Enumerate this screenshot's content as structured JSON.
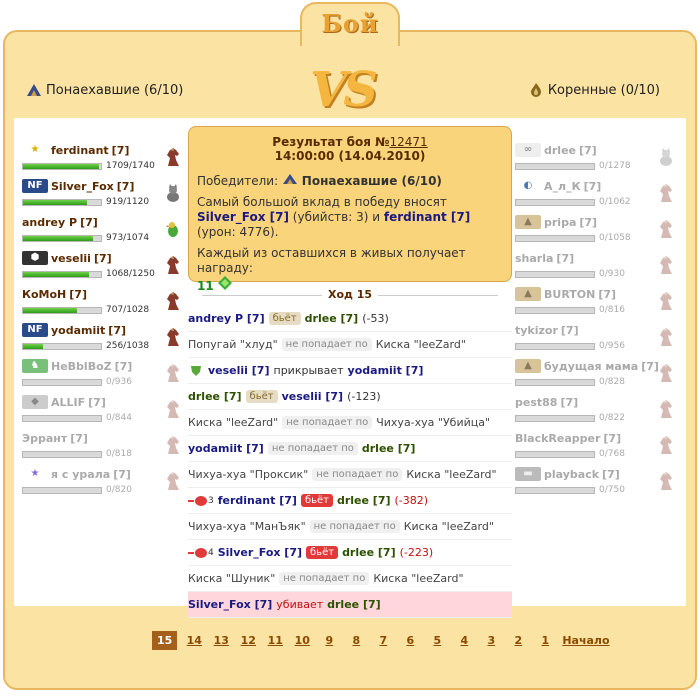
{
  "title": "Бой",
  "vs": "VS",
  "teams": {
    "left": {
      "name": "Понаехавшие (6/10)",
      "icon": "mountain-icon"
    },
    "right": {
      "name": "Коренные (0/10)",
      "icon": "flame-icon"
    }
  },
  "left_fighters": [
    {
      "name": "ferdinant",
      "lvl": "[7]",
      "hp": "1709/1740",
      "hp_frac": 0.98,
      "clan": "star-icon",
      "sign": "horse-icon",
      "dead": false
    },
    {
      "name": "Silver_Fox",
      "lvl": "[7]",
      "hp": "919/1120",
      "hp_frac": 0.82,
      "clan": "nf-clan-icon",
      "sign": "cat-icon",
      "dead": false
    },
    {
      "name": "andrey P",
      "lvl": "[7]",
      "hp": "973/1074",
      "hp_frac": 0.9,
      "clan": "",
      "sign": "parrot-icon",
      "dead": false
    },
    {
      "name": "veselii",
      "lvl": "[7]",
      "hp": "1068/1250",
      "hp_frac": 0.85,
      "clan": "shield-clan-icon",
      "sign": "horse-icon",
      "dead": false
    },
    {
      "name": "КоМоН",
      "lvl": "[7]",
      "hp": "707/1028",
      "hp_frac": 0.69,
      "clan": "",
      "sign": "horse-icon",
      "dead": false
    },
    {
      "name": "yodamiit",
      "lvl": "[7]",
      "hp": "256/1038",
      "hp_frac": 0.25,
      "clan": "nf-clan-icon",
      "sign": "horse-icon",
      "dead": false
    },
    {
      "name": "HeBblBoZ",
      "lvl": "[7]",
      "hp": "0/936",
      "hp_frac": 0,
      "clan": "horse-clan-icon",
      "sign": "horse-icon",
      "dead": true
    },
    {
      "name": "ALLIF",
      "lvl": "[7]",
      "hp": "0/844",
      "hp_frac": 0,
      "clan": "wings-clan-icon",
      "sign": "horse-icon",
      "dead": true
    },
    {
      "name": "Эррант",
      "lvl": "[7]",
      "hp": "0/818",
      "hp_frac": 0,
      "clan": "",
      "sign": "horse-icon",
      "dead": true
    },
    {
      "name": "я с урала",
      "lvl": "[7]",
      "hp": "0/820",
      "hp_frac": 0,
      "clan": "star-purple-icon",
      "sign": "horse-icon",
      "dead": true
    }
  ],
  "right_fighters": [
    {
      "name": "drlee",
      "lvl": "[7]",
      "hp": "0/1278",
      "hp_frac": 0,
      "clan": "swirl-clan-icon",
      "sign": "cat-icon",
      "dead": true
    },
    {
      "name": "А_л_К",
      "lvl": "[7]",
      "hp": "0/1062",
      "hp_frac": 0,
      "clan": "d-clan-icon",
      "sign": "horse-icon",
      "dead": true
    },
    {
      "name": "pripa",
      "lvl": "[7]",
      "hp": "0/1058",
      "hp_frac": 0,
      "clan": "mountain-clan-icon",
      "sign": "horse-icon",
      "dead": true
    },
    {
      "name": "sharla",
      "lvl": "[7]",
      "hp": "0/930",
      "hp_frac": 0,
      "clan": "",
      "sign": "horse-icon",
      "dead": true
    },
    {
      "name": "BURTON",
      "lvl": "[7]",
      "hp": "0/816",
      "hp_frac": 0,
      "clan": "mountain-clan-icon",
      "sign": "horse-icon",
      "dead": true
    },
    {
      "name": "tykizor",
      "lvl": "[7]",
      "hp": "0/956",
      "hp_frac": 0,
      "clan": "",
      "sign": "horse-icon",
      "dead": true
    },
    {
      "name": "будущая мама",
      "lvl": "[7]",
      "hp": "0/828",
      "hp_frac": 0,
      "clan": "mountain-clan-icon",
      "sign": "horse-icon",
      "dead": true
    },
    {
      "name": "pest88",
      "lvl": "[7]",
      "hp": "0/822",
      "hp_frac": 0,
      "clan": "",
      "sign": "horse-icon",
      "dead": true
    },
    {
      "name": "BlackReapper",
      "lvl": "[7]",
      "hp": "0/768",
      "hp_frac": 0,
      "clan": "",
      "sign": "horse-icon",
      "dead": true
    },
    {
      "name": "playback",
      "lvl": "[7]",
      "hp": "0/750",
      "hp_frac": 0,
      "clan": "grey-clan-icon",
      "sign": "horse-icon",
      "dead": true
    }
  ],
  "result": {
    "title_prefix": "Результат боя №",
    "battle_no": "12471",
    "time": "14:00:00 (14.04.2010)",
    "winners_label": "Победители:",
    "winners_team": "Понаехавшие (6/10)",
    "contrib_pre": "Самый большой вклад в победу вносят",
    "contrib_p1": "Silver_Fox [7]",
    "contrib_mid": "(убийств: 3) и",
    "contrib_p2": "ferdinant [7]",
    "contrib_post": "(урон: 4776).",
    "reward_text": "Каждый из оставшихся в живых получает награду:",
    "reward_value": "11"
  },
  "turn_label": "Ход 15",
  "log": [
    {
      "type": "hit",
      "a": "andrey P [7]",
      "verb": "бьёт",
      "b": "drlee [7]",
      "dmg": "(-53)"
    },
    {
      "type": "pet-miss",
      "a": "Попугай \"хлуд\"",
      "verb": "не попадает по",
      "b": "Киска \"leeZard\""
    },
    {
      "type": "cover",
      "a": "veselii [7]",
      "verb": "прикрывает",
      "b": "yodamiit [7]"
    },
    {
      "type": "hit2",
      "a": "drlee [7]",
      "verb": "бьёт",
      "b": "veselii [7]",
      "dmg": "(-123)"
    },
    {
      "type": "pet-miss",
      "a": "Киска \"leeZard\"",
      "verb": "не попадает по",
      "b": "Чихуа-хуа \"Убийца\""
    },
    {
      "type": "pet-miss2",
      "a": "yodamiit [7]",
      "verb": "не попадает по",
      "b": "drlee [7]"
    },
    {
      "type": "pet-miss",
      "a": "Чихуа-хуа \"Проксик\"",
      "verb": "не попадает по",
      "b": "Киска \"leeZard\""
    },
    {
      "type": "crit",
      "count": "3",
      "a": "ferdinant [7]",
      "verb": "бьёт",
      "b": "drlee [7]",
      "dmg": "(-382)"
    },
    {
      "type": "pet-miss",
      "a": "Чихуа-хуа \"МанЪяк\"",
      "verb": "не попадает по",
      "b": "Киска \"leeZard\""
    },
    {
      "type": "crit",
      "count": "4",
      "a": "Silver_Fox [7]",
      "verb": "бьёт",
      "b": "drlee [7]",
      "dmg": "(-223)"
    },
    {
      "type": "pet-miss",
      "a": "Киска \"Шуник\"",
      "verb": "не попадает по",
      "b": "Киска \"leeZard\""
    },
    {
      "type": "kill",
      "a": "Silver_Fox [7]",
      "verb": "убивает",
      "b": "drlee [7]"
    }
  ],
  "pager": [
    "15",
    "14",
    "13",
    "12",
    "11",
    "10",
    "9",
    "8",
    "7",
    "6",
    "5",
    "4",
    "3",
    "2",
    "1",
    "Начало"
  ],
  "pager_current": "15"
}
